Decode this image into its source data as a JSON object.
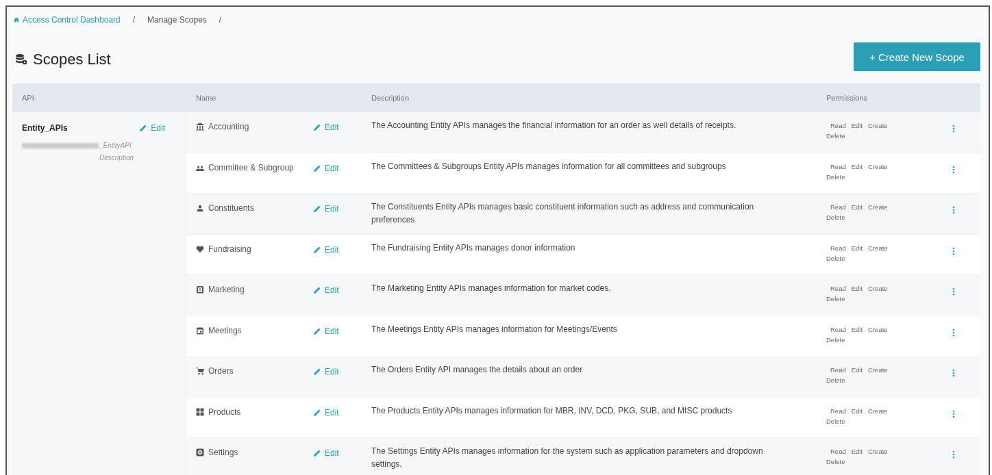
{
  "breadcrumb": [
    {
      "label": "Access Control Dashboard",
      "kind": "link"
    },
    {
      "label": "/",
      "kind": "separator"
    },
    {
      "label": "Manage Scopes",
      "kind": "current"
    },
    {
      "label": "/",
      "kind": "separator"
    }
  ],
  "title": "Scopes List",
  "create_button": "+ Create New Scope",
  "table": {
    "columns": [
      "API",
      "Name",
      "Description",
      "Permissions"
    ],
    "api": {
      "name": "Entity_APIs",
      "edit": "Edit",
      "description": "_EntityAPI Description"
    },
    "rows": [
      {
        "name": "Accounting",
        "edit": "Edit",
        "description": "The Accounting Entity APIs manages the financial information for an order as well details of receipts.",
        "permissions": [
          "Read",
          "Edit",
          "Create",
          "Delete"
        ]
      },
      {
        "name": "Committee & Subgroup",
        "edit": "Edit",
        "description": "The Committees & Subgroups Entity APIs manages information for all committees and subgroups",
        "permissions": [
          "Read",
          "Edit",
          "Create",
          "Delete"
        ]
      },
      {
        "name": "Constituents",
        "edit": "Edit",
        "description": "The Constituents Entity APIs manages basic constituent information such as address and communication preferences",
        "permissions": [
          "Read",
          "Edit",
          "Create",
          "Delete"
        ]
      },
      {
        "name": "Fundraising",
        "edit": "Edit",
        "description": "The Fundraising Entity APIs manages donor information",
        "permissions": [
          "Read",
          "Edit",
          "Create",
          "Delete"
        ]
      },
      {
        "name": "Marketing",
        "edit": "Edit",
        "description": "The Marketing Entity APIs manages information for market codes.",
        "permissions": [
          "Read",
          "Edit",
          "Create",
          "Delete"
        ]
      },
      {
        "name": "Meetings",
        "edit": "Edit",
        "description": "The Meetings Entity APIs manages information for Meetings/Events",
        "permissions": [
          "Read",
          "Edit",
          "Create",
          "Delete"
        ]
      },
      {
        "name": "Orders",
        "edit": "Edit",
        "description": "The Orders Entity API manages the details about an order",
        "permissions": [
          "Read",
          "Edit",
          "Create",
          "Delete"
        ]
      },
      {
        "name": "Products",
        "edit": "Edit",
        "description": "The Products Entity APIs manages information for MBR, INV, DCD, PKG, SUB, and MISC products",
        "permissions": [
          "Read",
          "Edit",
          "Create",
          "Delete"
        ]
      },
      {
        "name": "Settings",
        "edit": "Edit",
        "description": "The Settings Entity APIs manages information for the system such as application parameters and dropdown settings.",
        "permissions": [
          "Read",
          "Edit",
          "Create",
          "Delete"
        ]
      }
    ]
  }
}
